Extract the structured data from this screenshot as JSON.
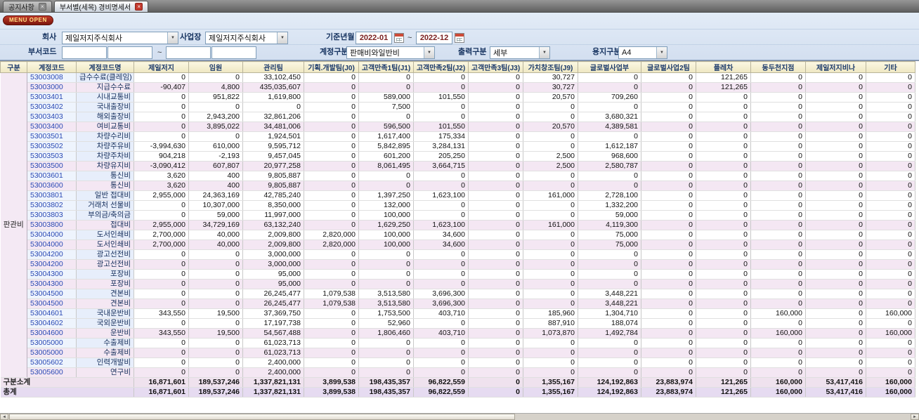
{
  "window": {
    "tabs": [
      {
        "label": "공지사항"
      },
      {
        "label": "부서별(세목) 경비명세서"
      }
    ]
  },
  "menu_open_label": "MENU OPEN",
  "filters": {
    "company_label": "회사",
    "company_value": "제일저지주식회사",
    "business_label": "사업장",
    "business_value": "제일저지주식회사",
    "period_label": "기준년월",
    "period_from": "2022-01",
    "period_to": "2022-12",
    "period_separator": "~",
    "dept_label": "부서코드",
    "dept_separator": "~",
    "account_label": "계정구분",
    "account_value": "판매비와일반비",
    "output_label": "출력구분",
    "output_value": "세부",
    "paper_label": "용지구분",
    "paper_value": "A4"
  },
  "grid": {
    "columns": [
      "구분",
      "계정코드",
      "계정코드명",
      "제일저지",
      "임원",
      "관리팀",
      "기획.개발팀(J0)",
      "고객만족1팀(J1)",
      "고객만족2팀(J2)",
      "고객만족3팀(J3)",
      "가치창조팀(J9)",
      "글로벌사업부",
      "글로벌사업2팀",
      "플레차",
      "동두천지점",
      "제일저지비나",
      "기타"
    ],
    "group_label": "판관비",
    "rows": [
      {
        "code": "53003008",
        "name": "급수수료(클레임)",
        "sub": false,
        "values": [
          "0",
          "0",
          "33,102,450",
          "0",
          "0",
          "0",
          "0",
          "30,727",
          "0",
          "0",
          "121,265",
          "0",
          "0",
          "0"
        ]
      },
      {
        "code": "53003000",
        "name": "지급수수료",
        "sub": true,
        "values": [
          "-90,407",
          "4,800",
          "435,035,607",
          "0",
          "0",
          "0",
          "0",
          "30,727",
          "0",
          "0",
          "121,265",
          "0",
          "0",
          "0"
        ]
      },
      {
        "code": "53003401",
        "name": "시내교통비",
        "sub": false,
        "values": [
          "0",
          "951,822",
          "1,619,800",
          "0",
          "589,000",
          "101,550",
          "0",
          "20,570",
          "709,260",
          "0",
          "0",
          "0",
          "0",
          "0"
        ]
      },
      {
        "code": "53003402",
        "name": "국내출장비",
        "sub": false,
        "values": [
          "0",
          "0",
          "0",
          "0",
          "7,500",
          "0",
          "0",
          "0",
          "0",
          "0",
          "0",
          "0",
          "0",
          "0"
        ]
      },
      {
        "code": "53003403",
        "name": "해외출장비",
        "sub": false,
        "values": [
          "0",
          "2,943,200",
          "32,861,206",
          "0",
          "0",
          "0",
          "0",
          "0",
          "3,680,321",
          "0",
          "0",
          "0",
          "0",
          "0"
        ]
      },
      {
        "code": "53003400",
        "name": "여비교통비",
        "sub": true,
        "values": [
          "0",
          "3,895,022",
          "34,481,006",
          "0",
          "596,500",
          "101,550",
          "0",
          "20,570",
          "4,389,581",
          "0",
          "0",
          "0",
          "0",
          "0"
        ]
      },
      {
        "code": "53003501",
        "name": "차량수리비",
        "sub": false,
        "values": [
          "0",
          "0",
          "1,924,501",
          "0",
          "1,617,400",
          "175,334",
          "0",
          "0",
          "0",
          "0",
          "0",
          "0",
          "0",
          "0"
        ]
      },
      {
        "code": "53003502",
        "name": "차량주유비",
        "sub": false,
        "values": [
          "-3,994,630",
          "610,000",
          "9,595,712",
          "0",
          "5,842,895",
          "3,284,131",
          "0",
          "0",
          "1,612,187",
          "0",
          "0",
          "0",
          "0",
          "0"
        ]
      },
      {
        "code": "53003503",
        "name": "차량주차비",
        "sub": false,
        "values": [
          "904,218",
          "-2,193",
          "9,457,045",
          "0",
          "601,200",
          "205,250",
          "0",
          "2,500",
          "968,600",
          "0",
          "0",
          "0",
          "0",
          "0"
        ]
      },
      {
        "code": "53003500",
        "name": "차량유지비",
        "sub": true,
        "values": [
          "-3,090,412",
          "607,807",
          "20,977,258",
          "0",
          "8,061,495",
          "3,664,715",
          "0",
          "2,500",
          "2,580,787",
          "0",
          "0",
          "0",
          "0",
          "0"
        ]
      },
      {
        "code": "53003601",
        "name": "통신비",
        "sub": false,
        "values": [
          "3,620",
          "400",
          "9,805,887",
          "0",
          "0",
          "0",
          "0",
          "0",
          "0",
          "0",
          "0",
          "0",
          "0",
          "0"
        ]
      },
      {
        "code": "53003600",
        "name": "통신비",
        "sub": true,
        "values": [
          "3,620",
          "400",
          "9,805,887",
          "0",
          "0",
          "0",
          "0",
          "0",
          "0",
          "0",
          "0",
          "0",
          "0",
          "0"
        ]
      },
      {
        "code": "53003801",
        "name": "일반 접대비",
        "sub": false,
        "values": [
          "2,955,000",
          "24,363,169",
          "42,785,240",
          "0",
          "1,397,250",
          "1,623,100",
          "0",
          "161,000",
          "2,728,100",
          "0",
          "0",
          "0",
          "0",
          "0"
        ]
      },
      {
        "code": "53003802",
        "name": "거래처 선물비",
        "sub": false,
        "values": [
          "0",
          "10,307,000",
          "8,350,000",
          "0",
          "132,000",
          "0",
          "0",
          "0",
          "1,332,200",
          "0",
          "0",
          "0",
          "0",
          "0"
        ]
      },
      {
        "code": "53003803",
        "name": "부의금/축의금",
        "sub": false,
        "values": [
          "0",
          "59,000",
          "11,997,000",
          "0",
          "100,000",
          "0",
          "0",
          "0",
          "59,000",
          "0",
          "0",
          "0",
          "0",
          "0"
        ]
      },
      {
        "code": "53003800",
        "name": "접대비",
        "sub": true,
        "values": [
          "2,955,000",
          "34,729,169",
          "63,132,240",
          "0",
          "1,629,250",
          "1,623,100",
          "0",
          "161,000",
          "4,119,300",
          "0",
          "0",
          "0",
          "0",
          "0"
        ]
      },
      {
        "code": "53004000",
        "name": "도서인쇄비",
        "sub": false,
        "values": [
          "2,700,000",
          "40,000",
          "2,009,800",
          "2,820,000",
          "100,000",
          "34,600",
          "0",
          "0",
          "75,000",
          "0",
          "0",
          "0",
          "0",
          "0"
        ]
      },
      {
        "code": "53004000",
        "name": "도서인쇄비",
        "sub": true,
        "values": [
          "2,700,000",
          "40,000",
          "2,009,800",
          "2,820,000",
          "100,000",
          "34,600",
          "0",
          "0",
          "75,000",
          "0",
          "0",
          "0",
          "0",
          "0"
        ]
      },
      {
        "code": "53004200",
        "name": "광고선전비",
        "sub": false,
        "values": [
          "0",
          "0",
          "3,000,000",
          "0",
          "0",
          "0",
          "0",
          "0",
          "0",
          "0",
          "0",
          "0",
          "0",
          "0"
        ]
      },
      {
        "code": "53004200",
        "name": "광고선전비",
        "sub": true,
        "values": [
          "0",
          "0",
          "3,000,000",
          "0",
          "0",
          "0",
          "0",
          "0",
          "0",
          "0",
          "0",
          "0",
          "0",
          "0"
        ]
      },
      {
        "code": "53004300",
        "name": "포장비",
        "sub": false,
        "values": [
          "0",
          "0",
          "95,000",
          "0",
          "0",
          "0",
          "0",
          "0",
          "0",
          "0",
          "0",
          "0",
          "0",
          "0"
        ]
      },
      {
        "code": "53004300",
        "name": "포장비",
        "sub": true,
        "values": [
          "0",
          "0",
          "95,000",
          "0",
          "0",
          "0",
          "0",
          "0",
          "0",
          "0",
          "0",
          "0",
          "0",
          "0"
        ]
      },
      {
        "code": "53004500",
        "name": "견본비",
        "sub": false,
        "values": [
          "0",
          "0",
          "26,245,477",
          "1,079,538",
          "3,513,580",
          "3,696,300",
          "0",
          "0",
          "3,448,221",
          "0",
          "0",
          "0",
          "0",
          "0"
        ]
      },
      {
        "code": "53004500",
        "name": "견본비",
        "sub": true,
        "values": [
          "0",
          "0",
          "26,245,477",
          "1,079,538",
          "3,513,580",
          "3,696,300",
          "0",
          "0",
          "3,448,221",
          "0",
          "0",
          "0",
          "0",
          "0"
        ]
      },
      {
        "code": "53004601",
        "name": "국내운반비",
        "sub": false,
        "values": [
          "343,550",
          "19,500",
          "37,369,750",
          "0",
          "1,753,500",
          "403,710",
          "0",
          "185,960",
          "1,304,710",
          "0",
          "0",
          "160,000",
          "0",
          "160,000"
        ]
      },
      {
        "code": "53004602",
        "name": "국외운반비",
        "sub": false,
        "values": [
          "0",
          "0",
          "17,197,738",
          "0",
          "52,960",
          "0",
          "0",
          "887,910",
          "188,074",
          "0",
          "0",
          "0",
          "0",
          "0"
        ]
      },
      {
        "code": "53004600",
        "name": "운반비",
        "sub": true,
        "values": [
          "343,550",
          "19,500",
          "54,567,488",
          "0",
          "1,806,460",
          "403,710",
          "0",
          "1,073,870",
          "1,492,784",
          "0",
          "0",
          "160,000",
          "0",
          "160,000"
        ]
      },
      {
        "code": "53005000",
        "name": "수출제비",
        "sub": false,
        "values": [
          "0",
          "0",
          "61,023,713",
          "0",
          "0",
          "0",
          "0",
          "0",
          "0",
          "0",
          "0",
          "0",
          "0",
          "0"
        ]
      },
      {
        "code": "53005000",
        "name": "수출제비",
        "sub": true,
        "values": [
          "0",
          "0",
          "61,023,713",
          "0",
          "0",
          "0",
          "0",
          "0",
          "0",
          "0",
          "0",
          "0",
          "0",
          "0"
        ]
      },
      {
        "code": "53005602",
        "name": "인력개발비",
        "sub": false,
        "values": [
          "0",
          "0",
          "2,400,000",
          "0",
          "0",
          "0",
          "0",
          "0",
          "0",
          "0",
          "0",
          "0",
          "0",
          "0"
        ]
      },
      {
        "code": "53005600",
        "name": "연구비",
        "sub": true,
        "values": [
          "0",
          "0",
          "2,400,000",
          "0",
          "0",
          "0",
          "0",
          "0",
          "0",
          "0",
          "0",
          "0",
          "0",
          "0"
        ]
      }
    ],
    "footer": [
      {
        "label": "구분소계",
        "values": [
          "16,871,601",
          "189,537,246",
          "1,337,821,131",
          "3,899,538",
          "198,435,357",
          "96,822,559",
          "0",
          "1,355,167",
          "124,192,863",
          "23,883,974",
          "121,265",
          "160,000",
          "53,417,416",
          "160,000"
        ]
      },
      {
        "label": "총계",
        "values": [
          "16,871,601",
          "189,537,246",
          "1,337,821,131",
          "3,899,538",
          "198,435,357",
          "96,822,559",
          "0",
          "1,355,167",
          "124,192,863",
          "23,883,974",
          "121,265",
          "160,000",
          "53,417,416",
          "160,000"
        ]
      }
    ]
  }
}
